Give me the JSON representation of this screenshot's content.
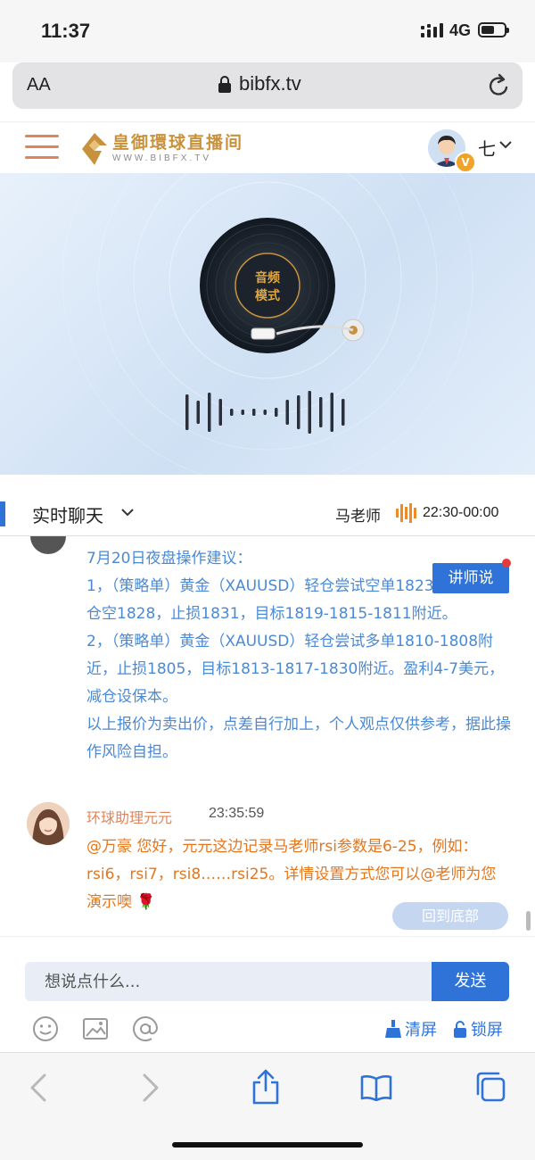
{
  "status_bar": {
    "time": "11:37",
    "network": "4G"
  },
  "url_bar": {
    "text_size_label": "AA",
    "domain": "bibfx.tv"
  },
  "site_header": {
    "logo_title": "皇御環球直播间",
    "logo_url": "WWW.BIBFX.TV",
    "user_name": "七"
  },
  "player": {
    "mode_label_line1": "音频",
    "mode_label_line2": "模式"
  },
  "chat_bar": {
    "tab_label": "实时聊天",
    "teacher": "马老师",
    "schedule": "22:30-00:00"
  },
  "messages": [
    {
      "text": "7月20日夜盘操作建议：\n1，（策略单）黄金（XAUUSD）轻仓尝试空单1823.5附近，补仓空1828，止损1831，目标1819-1815-1811附近。\n2，（策略单）黄金（XAUUSD）轻仓尝试多单1810-1808附近，止损1805，目标1813-1817-1830附近。盈利4-7美元，减仓设保本。\n以上报价为卖出价，点差自行加上，个人观点仅供参考，据此操作风险自担。"
    },
    {
      "sender": "环球助理元元",
      "time": "23:35:59",
      "text": "@万豪   您好，元元这边记录马老师rsi参数是6-25，例如：rsi6，rsi7，rsi8……rsi25。详情设置方式您可以@老师为您演示噢 🌹"
    }
  ],
  "teacher_says_label": "讲师说",
  "back_to_bottom_label": "回到底部",
  "composer": {
    "placeholder": "想说点什么...",
    "send_label": "发送",
    "clear_label": "清屏",
    "lock_label": "锁屏"
  },
  "colors": {
    "accent_blue": "#2f73d9",
    "message_blue": "#4a8ad4",
    "assistant_orange": "#e5761c",
    "logo_gold": "#c8923d"
  }
}
